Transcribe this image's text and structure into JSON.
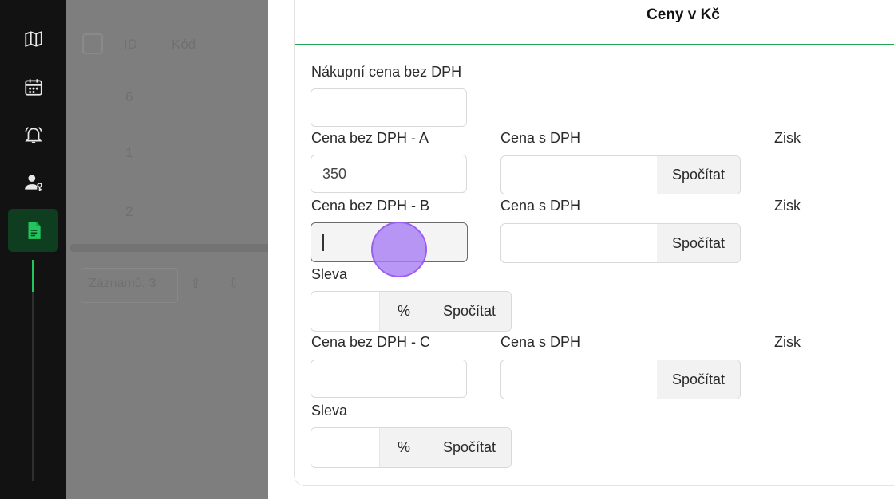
{
  "sidebar": {
    "items": [
      {
        "icon": "map-icon",
        "active": false
      },
      {
        "icon": "calendar-icon",
        "active": false
      },
      {
        "icon": "bell-icon",
        "active": false
      },
      {
        "icon": "user-key-icon",
        "active": false
      },
      {
        "icon": "document-icon",
        "active": true
      }
    ]
  },
  "background": {
    "col_id": "ID",
    "col_kod": "Kód",
    "rows": [
      "6",
      "1",
      "2"
    ],
    "footer_count": "Záznamů: 3"
  },
  "prices": {
    "title": "Ceny v Kč",
    "purchase_label": "Nákupní cena bez DPH",
    "purchase_value": "",
    "a": {
      "label": "Cena bez DPH - A",
      "value": "350",
      "vat_label": "Cena s DPH",
      "vat_value": "",
      "calc": "Spočítat",
      "profit": "Zisk"
    },
    "b": {
      "label": "Cena bez DPH - B",
      "value": "",
      "vat_label": "Cena s DPH",
      "vat_value": "",
      "calc": "Spočítat",
      "profit": "Zisk"
    },
    "b_discount": {
      "label": "Sleva",
      "value": "",
      "unit": "%",
      "calc": "Spočítat"
    },
    "c": {
      "label": "Cena bez DPH - C",
      "value": "",
      "vat_label": "Cena s DPH",
      "vat_value": "",
      "calc": "Spočítat",
      "profit": "Zisk"
    },
    "c_discount": {
      "label": "Sleva",
      "value": "",
      "unit": "%",
      "calc": "Spočítat"
    }
  },
  "colors": {
    "accent": "#22c55e",
    "sidebar": "#121212",
    "cursor": "#a77df5"
  }
}
